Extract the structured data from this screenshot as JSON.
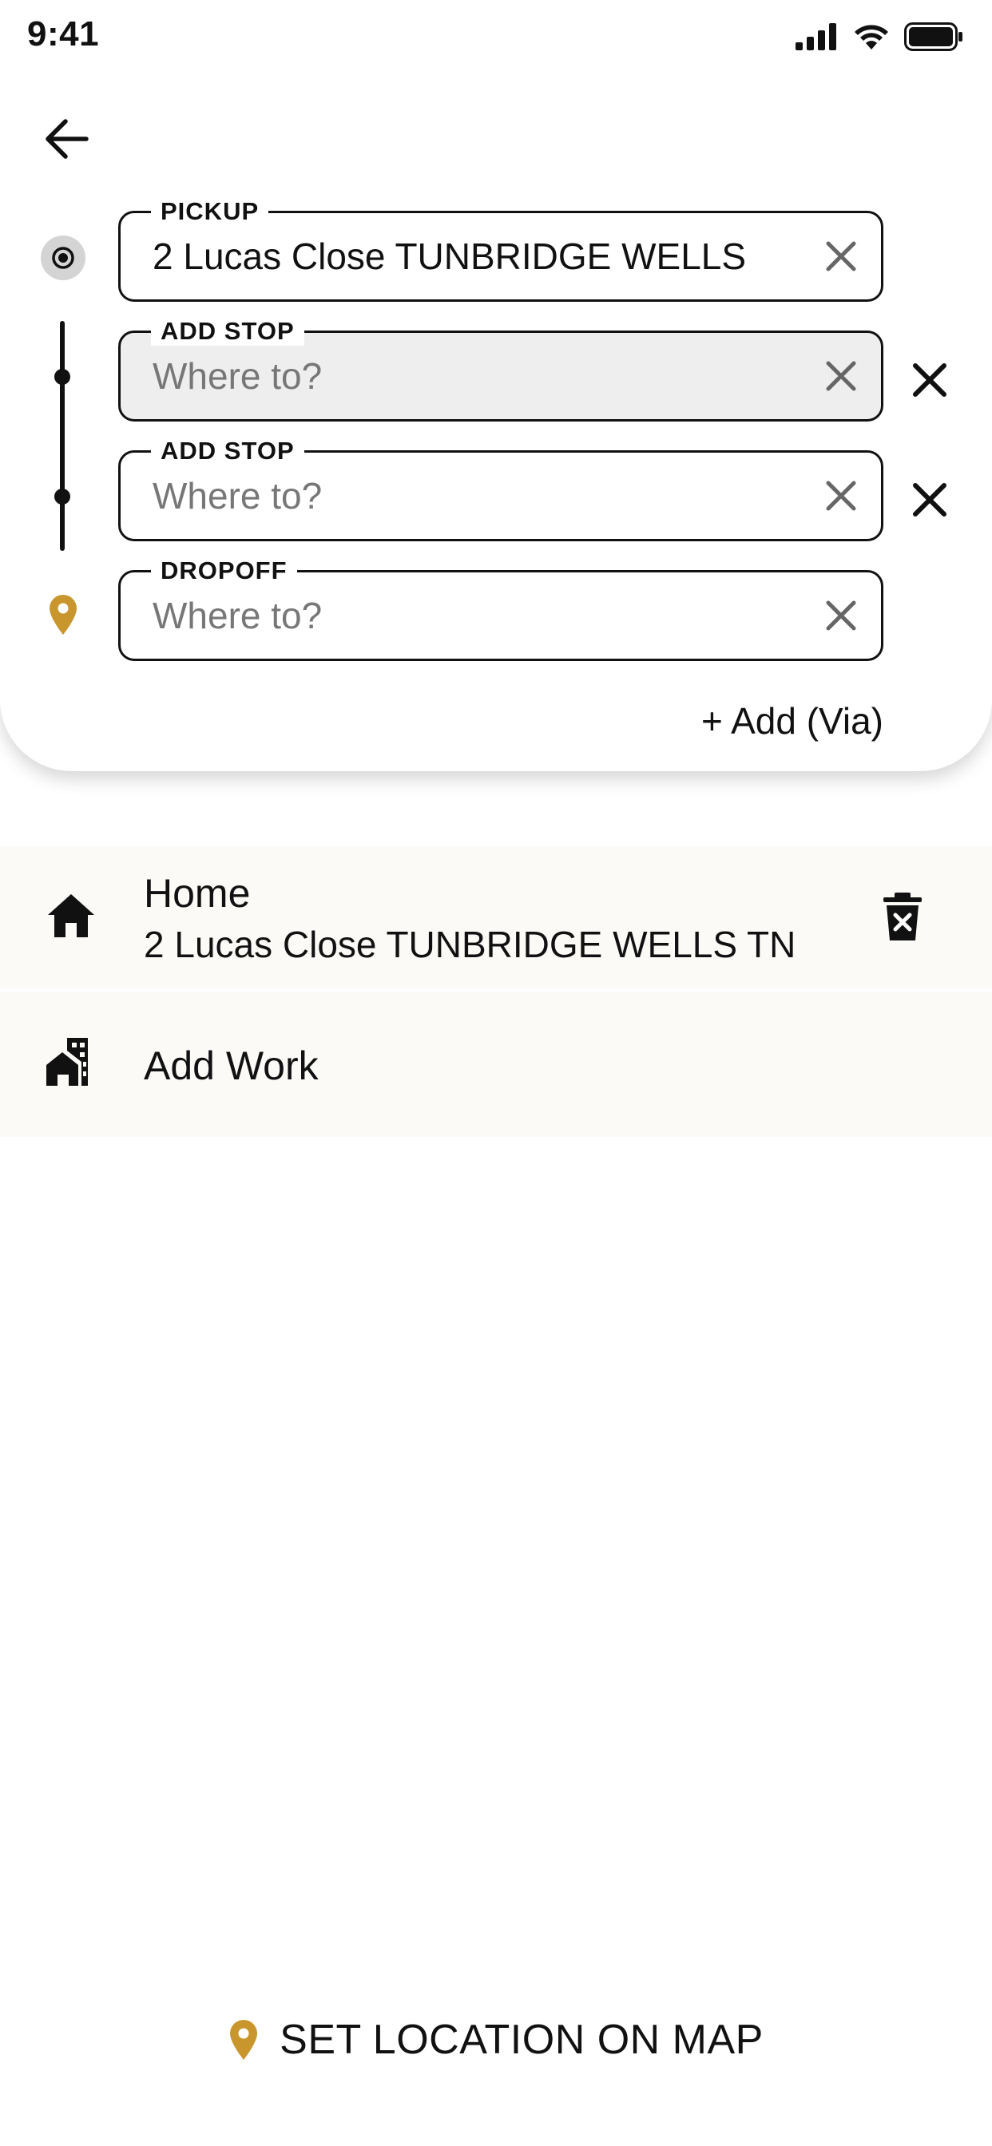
{
  "status_bar": {
    "time": "9:41",
    "icons": [
      "signal-icon",
      "wifi-icon",
      "battery-icon"
    ]
  },
  "header": {
    "back_icon": "arrow-left-icon"
  },
  "route": {
    "pickup": {
      "label": "PICKUP",
      "value": "2 Lucas Close TUNBRIDGE WELLS",
      "placeholder": "Where to?"
    },
    "stops": [
      {
        "label": "ADD STOP",
        "value": "",
        "placeholder": "Where to?"
      },
      {
        "label": "ADD STOP",
        "value": "",
        "placeholder": "Where to?"
      }
    ],
    "dropoff": {
      "label": "DROPOFF",
      "value": "",
      "placeholder": "Where to?"
    },
    "add_via_label": "+ Add (Via)"
  },
  "saved_places": [
    {
      "icon": "home-icon",
      "title": "Home",
      "subtitle": "2 Lucas Close TUNBRIDGE WELLS TN"
    },
    {
      "icon": "work-building-icon",
      "title": "Add Work"
    }
  ],
  "footer": {
    "map_link_label": "SET LOCATION ON MAP"
  },
  "colors": {
    "accent_gold": "#c8962c",
    "text": "#111111",
    "placeholder": "#777777",
    "shaded_field": "#eeeeee",
    "row_background": "#fbfaf7"
  }
}
